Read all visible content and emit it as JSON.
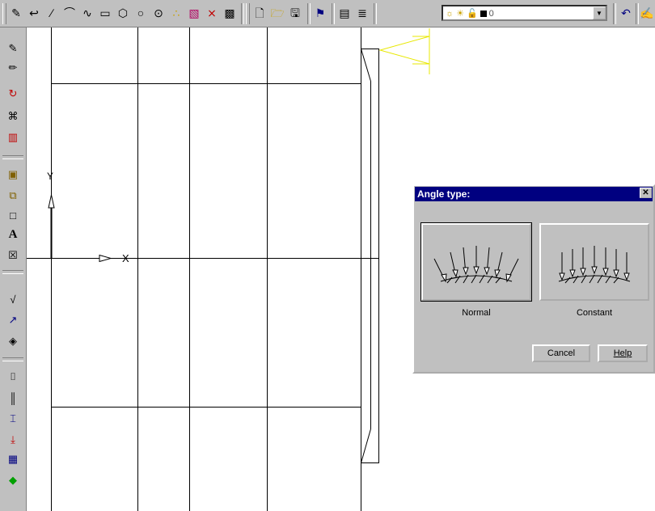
{
  "toolbar_top": {
    "icons": [
      "edit-icon",
      "undo-arc-icon",
      "line-icon",
      "arc-icon",
      "spline-icon",
      "rectangle-icon",
      "polygon-icon",
      "circle-icon",
      "dots-icon",
      "hatch-icon",
      "intersect-icon",
      "modify-icon",
      "new-file-icon",
      "open-folder-icon",
      "save-icon",
      "properties-icon",
      "display-icon",
      "layers-icon"
    ],
    "layer_value": "0",
    "undo_icon": "undo-icon",
    "redo_icon": "pen-icon"
  },
  "toolbar_left": {
    "icons": [
      "edit-1-icon",
      "edit-2-icon",
      "rotate-icon",
      "group-icon",
      "mirror-icon",
      "select-icon",
      "copy-icon",
      "window-icon",
      "text-icon",
      "symbol-icon",
      "angle-icon",
      "sweep-icon",
      "fill-icon",
      "dim-1-icon",
      "dim-2-icon",
      "dim-3-icon",
      "export-icon",
      "grid-icon",
      "color-icon"
    ],
    "text_label": "A"
  },
  "axes": {
    "y_label": "Y",
    "x_label": "X"
  },
  "dialog": {
    "title": "Angle type:",
    "close": "✕",
    "options": [
      {
        "label": "Normal",
        "selected": true
      },
      {
        "label": "Constant",
        "selected": false
      }
    ],
    "cancel": "Cancel",
    "help": "Help"
  }
}
